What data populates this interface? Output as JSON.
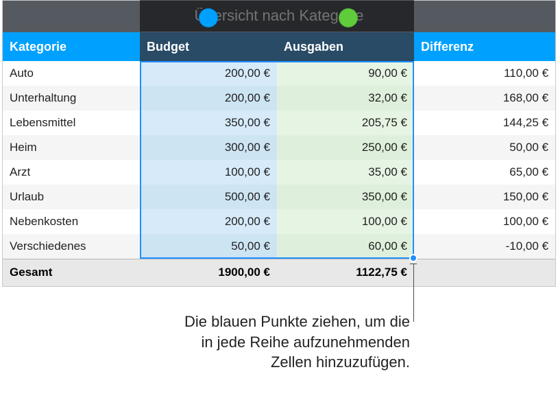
{
  "title": "Übersicht nach Kategorie",
  "columns": {
    "category": "Kategorie",
    "budget": "Budget",
    "expenses": "Ausgaben",
    "diff": "Differenz"
  },
  "rows": [
    {
      "cat": "Auto",
      "bud": "200,00 €",
      "aus": "90,00 €",
      "dif": "110,00 €"
    },
    {
      "cat": "Unterhaltung",
      "bud": "200,00 €",
      "aus": "32,00 €",
      "dif": "168,00 €"
    },
    {
      "cat": "Lebensmittel",
      "bud": "350,00 €",
      "aus": "205,75 €",
      "dif": "144,25 €"
    },
    {
      "cat": "Heim",
      "bud": "300,00 €",
      "aus": "250,00 €",
      "dif": "50,00 €"
    },
    {
      "cat": "Arzt",
      "bud": "100,00 €",
      "aus": "35,00 €",
      "dif": "65,00 €"
    },
    {
      "cat": "Urlaub",
      "bud": "500,00 €",
      "aus": "350,00 €",
      "dif": "150,00 €"
    },
    {
      "cat": "Nebenkosten",
      "bud": "200,00 €",
      "aus": "100,00 €",
      "dif": "100,00 €"
    },
    {
      "cat": "Verschiedenes",
      "bud": "50,00 €",
      "aus": "60,00 €",
      "dif": "-10,00 €"
    }
  ],
  "total": {
    "label": "Gesamt",
    "bud": "1900,00 €",
    "aus": "1122,75 €",
    "dif": ""
  },
  "callout": {
    "line1": "Die blauen Punkte ziehen, um die",
    "line2": "in jede Reihe aufzunehmenden",
    "line3": "Zellen hinzuzufügen."
  },
  "chart_dots": {
    "blue": {
      "series": "Budget"
    },
    "green": {
      "series": "Ausgaben"
    }
  }
}
